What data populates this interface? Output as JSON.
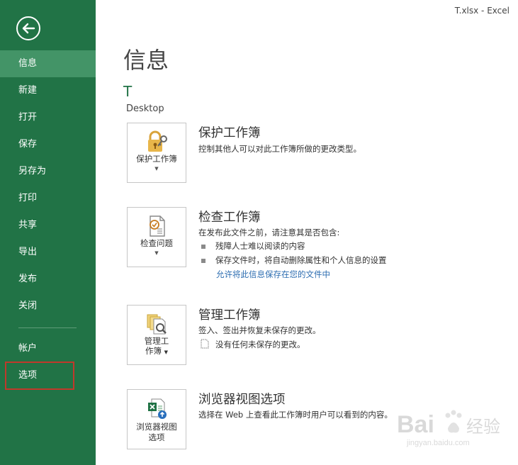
{
  "window": {
    "title": "T.xlsx - Excel"
  },
  "sidebar": {
    "items": [
      {
        "label": "信息"
      },
      {
        "label": "新建"
      },
      {
        "label": "打开"
      },
      {
        "label": "保存"
      },
      {
        "label": "另存为"
      },
      {
        "label": "打印"
      },
      {
        "label": "共享"
      },
      {
        "label": "导出"
      },
      {
        "label": "发布"
      },
      {
        "label": "关闭"
      },
      {
        "label": "帐户"
      },
      {
        "label": "选项"
      }
    ],
    "active_index": 0
  },
  "main": {
    "title": "信息",
    "file_name": "T",
    "file_location": "Desktop",
    "sections": [
      {
        "tile_label": "保护工作簿",
        "heading": "保护工作簿",
        "description": "控制其他人可以对此工作簿所做的更改类型。",
        "icon": "lock-key-icon"
      },
      {
        "tile_label": "检查问题",
        "heading": "检查工作簿",
        "description": "在发布此文件之前，请注意其是否包含:",
        "bullets": [
          "残障人士难以阅读的内容",
          "保存文件时，将自动删除属性和个人信息的设置"
        ],
        "link": "允许将此信息保存在您的文件中",
        "icon": "inspect-document-icon"
      },
      {
        "tile_label_1": "管理工",
        "tile_label_2": "作簿",
        "heading": "管理工作簿",
        "description": "签入、签出并恢复未保存的更改。",
        "note": "没有任何未保存的更改。",
        "icon": "manage-workbook-icon"
      },
      {
        "tile_label_1": "浏览器视图",
        "tile_label_2": "选项",
        "heading": "浏览器视图选项",
        "description": "选择在 Web 上查看此工作簿时用户可以看到的内容。",
        "icon": "browser-view-icon"
      }
    ]
  },
  "watermark": {
    "brand": "Bai",
    "brand2": "经验",
    "url": "jingyan.baidu.com"
  },
  "colors": {
    "sidebar": "#217346",
    "active": "#439467",
    "link": "#2b6cb0",
    "highlight": "#c0392b"
  }
}
